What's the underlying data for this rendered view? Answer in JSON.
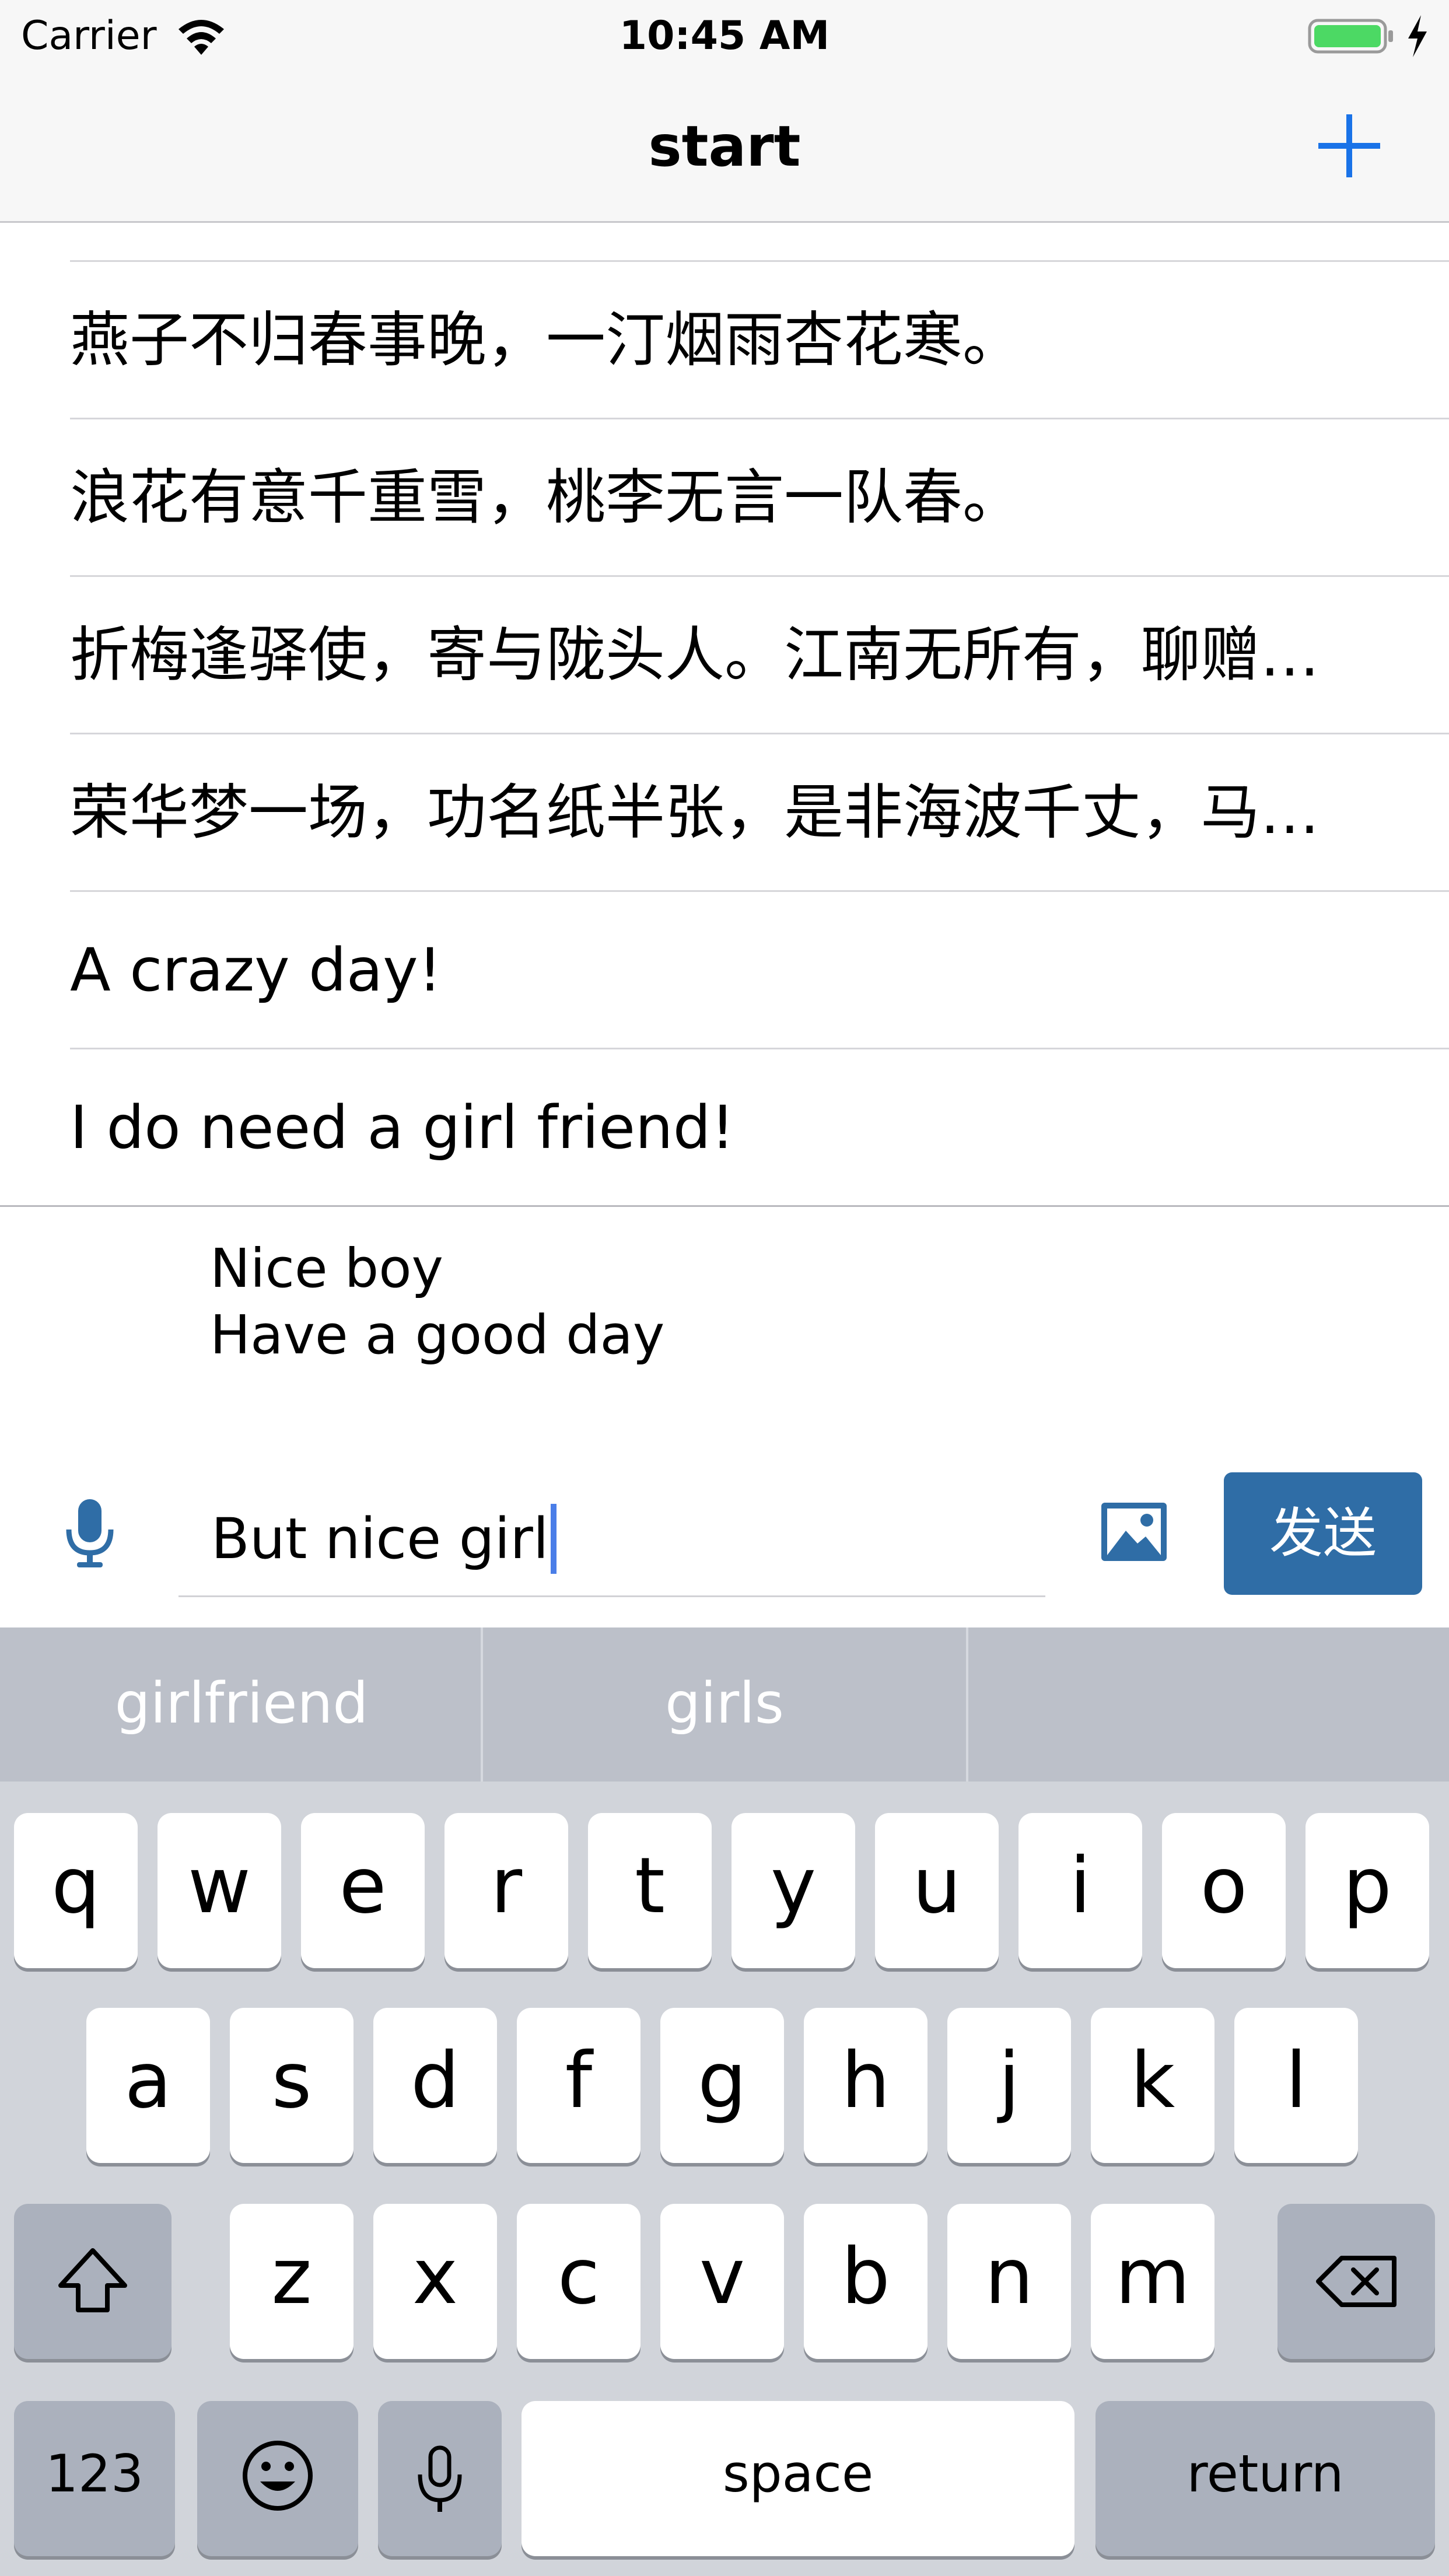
{
  "status_bar": {
    "carrier": "Carrier",
    "time": "10:45 AM",
    "battery_color": "#4cd964"
  },
  "nav": {
    "title": "start",
    "add_icon": "plus-icon",
    "tint": "#1a73e8"
  },
  "rows": [
    "燕子不归春事晚，一汀烟雨杏花寒。",
    "浪花有意千重雪，桃李无言一队春。",
    "折梅逢驿使，寄与陇头人。江南无所有，聊赠…",
    "荣华梦一场，功名纸半张，是非海波千丈，马…",
    "A crazy day!",
    "I do need a girl friend!"
  ],
  "preview": {
    "line1": "Nice boy",
    "line2": "Have a good day"
  },
  "input_bar": {
    "mic_icon": "microphone-icon",
    "message_value": "But nice girl",
    "image_icon": "image-icon",
    "send_label": "发送",
    "send_color": "#2f6da6"
  },
  "keyboard": {
    "suggestions": [
      "girlfriend",
      "girls",
      ""
    ],
    "row1": [
      "q",
      "w",
      "e",
      "r",
      "t",
      "y",
      "u",
      "i",
      "o",
      "p"
    ],
    "row2": [
      "a",
      "s",
      "d",
      "f",
      "g",
      "h",
      "j",
      "k",
      "l"
    ],
    "row3": [
      "z",
      "x",
      "c",
      "v",
      "b",
      "n",
      "m"
    ],
    "numbers_label": "123",
    "space_label": "space",
    "return_label": "return"
  }
}
